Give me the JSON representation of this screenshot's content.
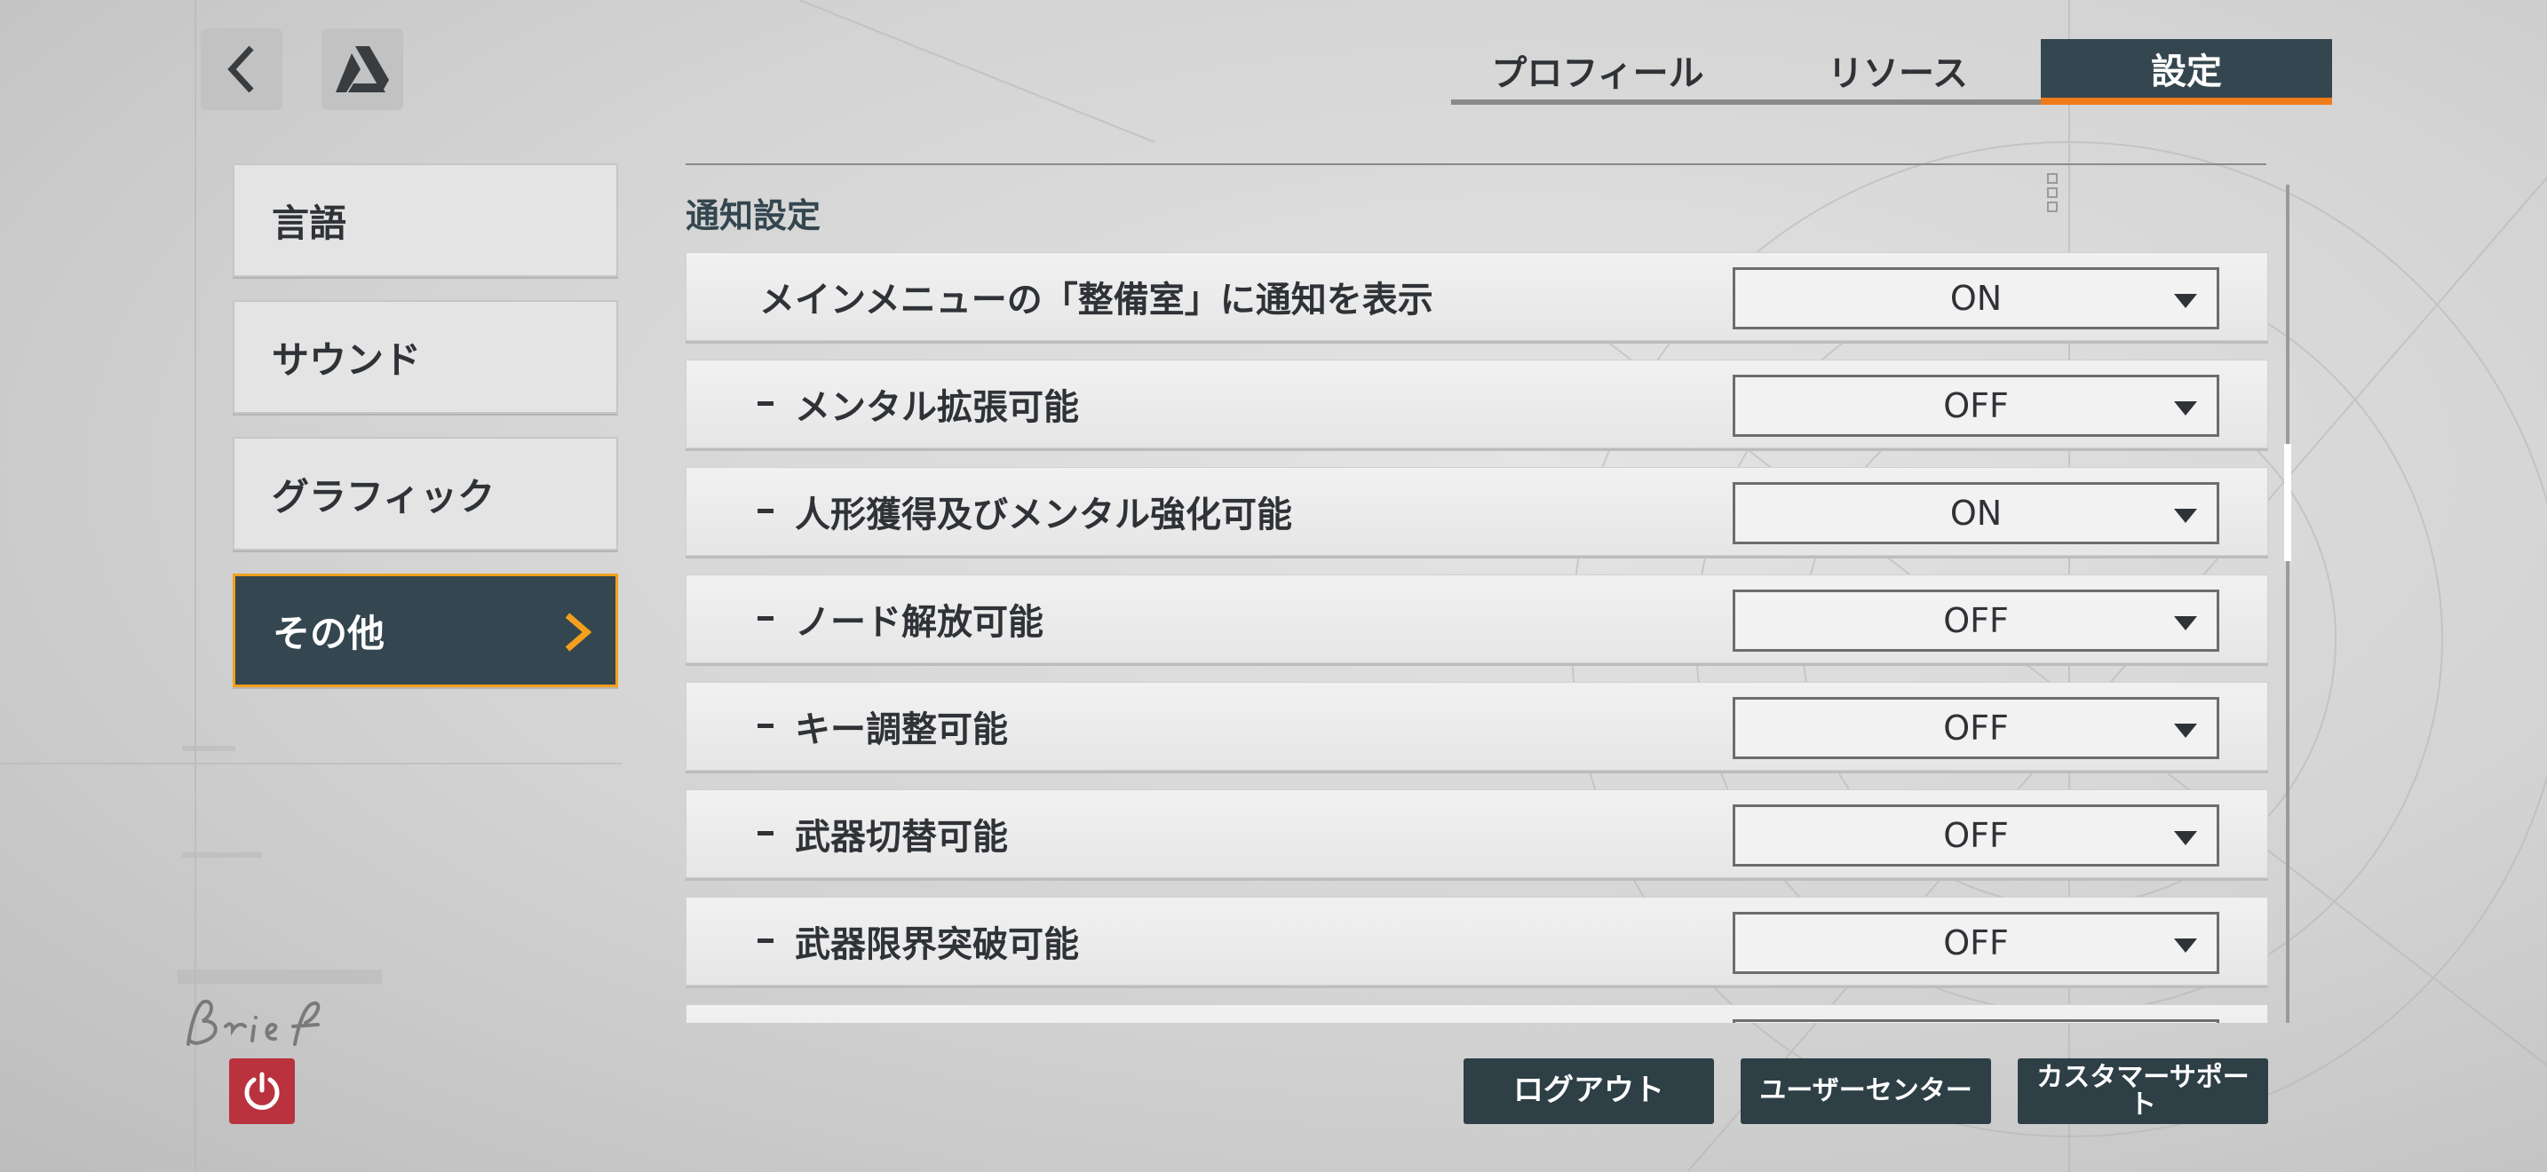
{
  "top_bar": {
    "back_icon": "chevron-left-icon",
    "logo_icon": "triangle-logo-icon",
    "tabs": [
      {
        "label": "プロフィール",
        "code": "",
        "active": false
      },
      {
        "label": "リソース",
        "code": "",
        "active": false
      },
      {
        "label": "設定",
        "code": "",
        "active": true
      }
    ],
    "accent_color": "#f07a18"
  },
  "sidebar": {
    "items": [
      {
        "label": "言語",
        "code": "",
        "active": false
      },
      {
        "label": "サウンド",
        "code": "",
        "active": false
      },
      {
        "label": "グラフィック",
        "code": "",
        "active": false
      },
      {
        "label": "その他",
        "code": "",
        "active": true
      }
    ],
    "active_border_color": "#f3a01c"
  },
  "main": {
    "section_title": "通知設定",
    "rows": [
      {
        "label": "メインメニューの「整備室」に通知を表示",
        "sub": false,
        "value": "ON"
      },
      {
        "label": "メンタル拡張可能",
        "sub": true,
        "value": "OFF"
      },
      {
        "label": "人形獲得及びメンタル強化可能",
        "sub": true,
        "value": "ON"
      },
      {
        "label": "ノード解放可能",
        "sub": true,
        "value": "OFF"
      },
      {
        "label": "キー調整可能",
        "sub": true,
        "value": "OFF"
      },
      {
        "label": "武器切替可能",
        "sub": true,
        "value": "OFF"
      },
      {
        "label": "武器限界突破可能",
        "sub": true,
        "value": "OFF"
      },
      {
        "label": "",
        "sub": false,
        "value": ""
      }
    ],
    "scroll_position": 0.3
  },
  "footer": {
    "logout": "ログアウト",
    "user_center": "ユーザーセンター",
    "customer_support": "カスタマーサポート",
    "power_icon": "power-icon",
    "brand_scribble": "Brief",
    "power_color": "#b9323e"
  }
}
